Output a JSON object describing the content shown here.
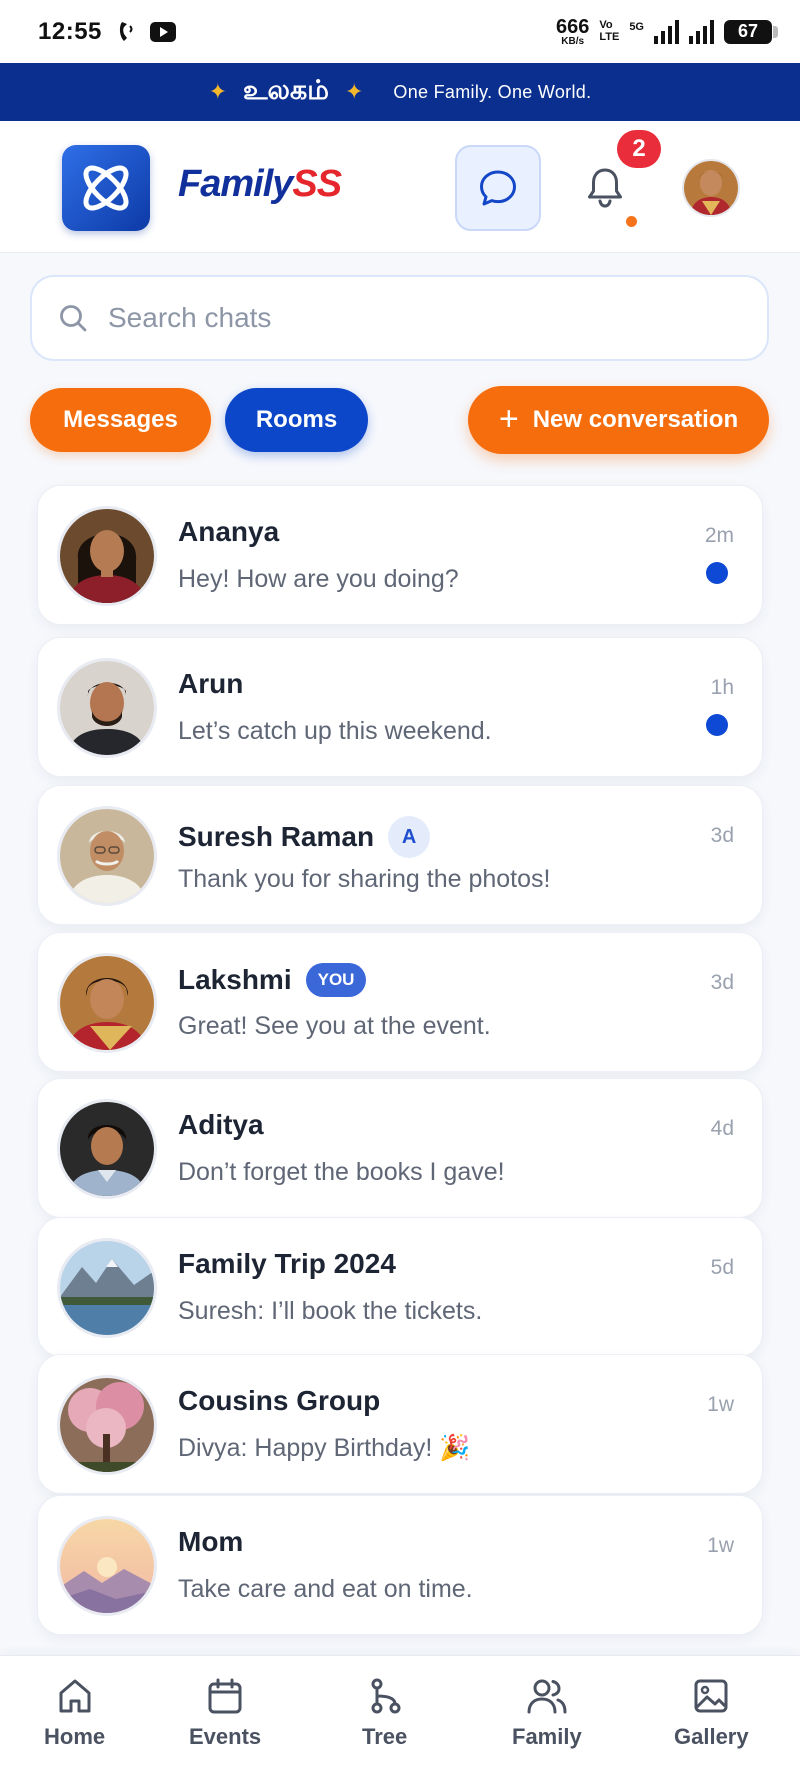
{
  "status_bar": {
    "time": "12:55",
    "net_speed": "666",
    "net_unit": "KB/s",
    "volte_top": "Vo",
    "volte_bottom": "LTE",
    "network": "5G",
    "battery": "67"
  },
  "banner": {
    "tamil_text": "உலகம்",
    "slogan": "One Family. One World.",
    "star_color": "#f5b72e",
    "background": "#0b2f8f"
  },
  "header": {
    "brand_part1": "Family",
    "brand_part2": "SS",
    "notification_count": "2",
    "icons": [
      "logo-icon",
      "chat-bubble-icon",
      "bell-icon",
      "user-avatar"
    ]
  },
  "search": {
    "placeholder": "Search chats",
    "value": ""
  },
  "tabs": {
    "messages": "Messages",
    "rooms": "Rooms",
    "new_conversation": "New conversation"
  },
  "colors": {
    "accent_orange": "#f56d0d",
    "accent_blue": "#0d47c9",
    "unread_dot": "#0e49d6",
    "badge_red": "#ea2d3a"
  },
  "conversations": [
    {
      "name": "Ananya",
      "message": "Hey! How are you doing?",
      "time": "2m",
      "unread": true
    },
    {
      "name": "Arun",
      "message": "Let’s catch up this weekend.",
      "time": "1h",
      "unread": true
    },
    {
      "name": "Suresh Raman",
      "badge": "A",
      "message": "Thank you for sharing the photos!",
      "time": "3d",
      "unread": false
    },
    {
      "name": "Lakshmi",
      "badge": "YOU",
      "message": "Great! See you at the event.",
      "time": "3d",
      "unread": false
    },
    {
      "name": "Aditya",
      "message": "Don’t forget the books I gave!",
      "time": "4d",
      "unread": false
    },
    {
      "name": "Family Trip 2024",
      "message": "Suresh: I’ll book the tickets.",
      "time": "5d",
      "unread": false
    },
    {
      "name": "Cousins Group",
      "message": "Divya: Happy Birthday! 🎉",
      "time": "1w",
      "unread": false
    },
    {
      "name": "Mom",
      "message": "Take care and eat on time.",
      "time": "1w",
      "unread": false
    }
  ],
  "bottom_nav": [
    {
      "label": "Home",
      "icon": "home-icon"
    },
    {
      "label": "Events",
      "icon": "calendar-icon"
    },
    {
      "label": "Tree",
      "icon": "tree-icon"
    },
    {
      "label": "Family",
      "icon": "people-icon"
    },
    {
      "label": "Gallery",
      "icon": "image-icon"
    }
  ]
}
